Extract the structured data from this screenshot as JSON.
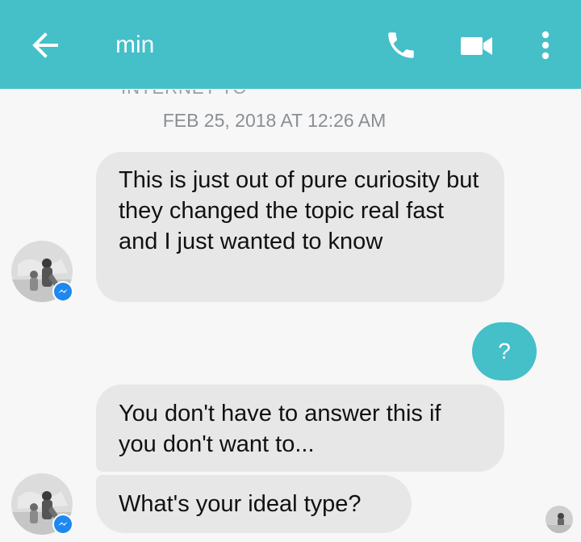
{
  "header": {
    "title": "min",
    "back_icon": "arrow-left-icon",
    "call_icon": "phone-icon",
    "video_icon": "video-camera-icon",
    "more_icon": "more-vertical-icon",
    "background_color": "#45bfc8"
  },
  "conversation": {
    "timestamp": "FEB 25, 2018 AT 12:26 AM",
    "clipped_text": "INTERNET TO"
  },
  "messages": [
    {
      "direction": "incoming",
      "text": "This is just out of pure curiosity but they changed the topic real fast and I just wanted to know"
    },
    {
      "direction": "outgoing",
      "text": "?"
    },
    {
      "direction": "incoming",
      "text": "You don't have to answer this if you don't want to..."
    },
    {
      "direction": "incoming",
      "text": "What's your ideal type?"
    }
  ],
  "colors": {
    "incoming_bubble": "#e7e7e7",
    "outgoing_bubble": "#45bfc8",
    "messenger_badge": "#1e88f0"
  }
}
